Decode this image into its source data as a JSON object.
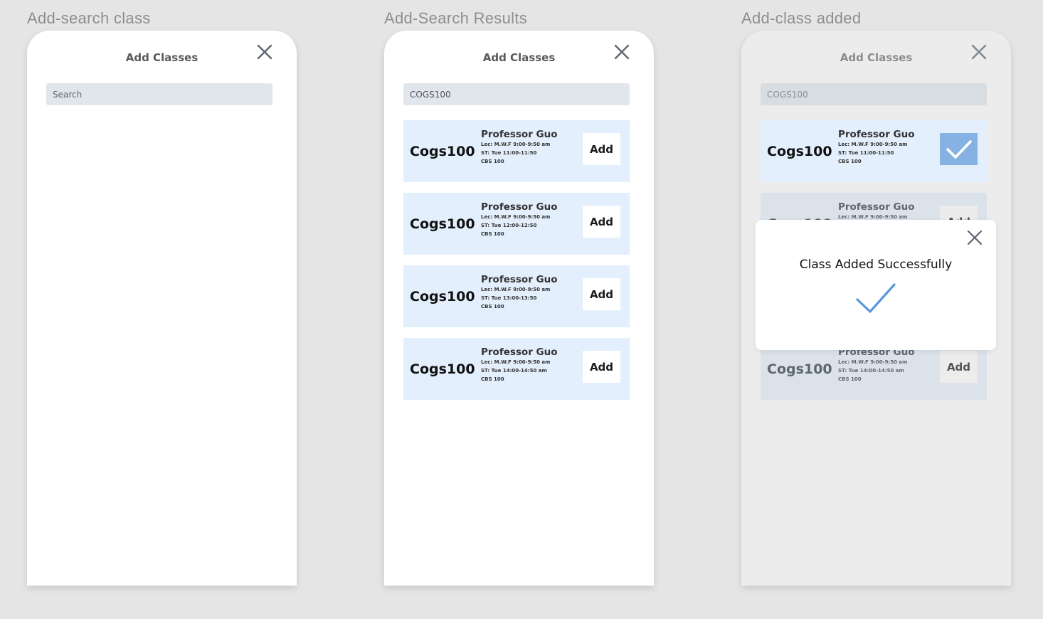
{
  "frames": [
    {
      "title": "Add-search class",
      "header": "Add Classes",
      "search": {
        "placeholder": "Search",
        "value": ""
      },
      "results": []
    },
    {
      "title": "Add-Search Results",
      "header": "Add Classes",
      "search": {
        "placeholder": "Search",
        "value": "COGS100"
      },
      "results": [
        {
          "code": "Cogs100",
          "professor": "Professor Guo",
          "lec": "Lec: M.W.F  9:00-9:50 am",
          "st": "ST: Tue 11:00-11:50",
          "room": "CBS 100",
          "action": "Add"
        },
        {
          "code": "Cogs100",
          "professor": "Professor Guo",
          "lec": "Lec: M.W.F  9:00-9:50 am",
          "st": "ST: Tue 12:00-12:50",
          "room": "CBS 100",
          "action": "Add"
        },
        {
          "code": "Cogs100",
          "professor": "Professor Guo",
          "lec": "Lec: M.W.F  9:00-9:50 am",
          "st": "ST: Tue 13:00-13:50",
          "room": "CBS 100",
          "action": "Add"
        },
        {
          "code": "Cogs100",
          "professor": "Professor Guo",
          "lec": "Lec: M.W.F  9:00-9:50 am",
          "st": "ST: Tue 14:00-14:50 am",
          "room": "CBS 100",
          "action": "Add"
        }
      ]
    },
    {
      "title": "Add-class added",
      "header": "Add Classes",
      "search": {
        "placeholder": "Search",
        "value": "COGS100"
      },
      "results": [
        {
          "code": "Cogs100",
          "professor": "Professor Guo",
          "lec": "Lec: M.W.F  9:00-9:50 am",
          "st": "ST: Tue 11:00-11:50",
          "room": "CBS 100",
          "state": "added"
        },
        {
          "code": "Cogs100",
          "professor": "Professor Guo",
          "lec": "Lec: M.W.F  9:00-9:50 am",
          "action": "Add"
        },
        {
          "code": "Cogs100",
          "professor": "Professor Guo",
          "lec": "Lec: M.W.F  9:00-9:50 am",
          "st": "ST: Tue 14:00-14:50 am",
          "room": "CBS 100",
          "action": "Add"
        }
      ],
      "modal": {
        "message": "Class Added Successfully"
      }
    }
  ],
  "colors": {
    "card_bg": "#e3effc",
    "check_accent": "#86b1e3",
    "modal_check": "#5b95de",
    "close_icon": "#5f6670"
  }
}
